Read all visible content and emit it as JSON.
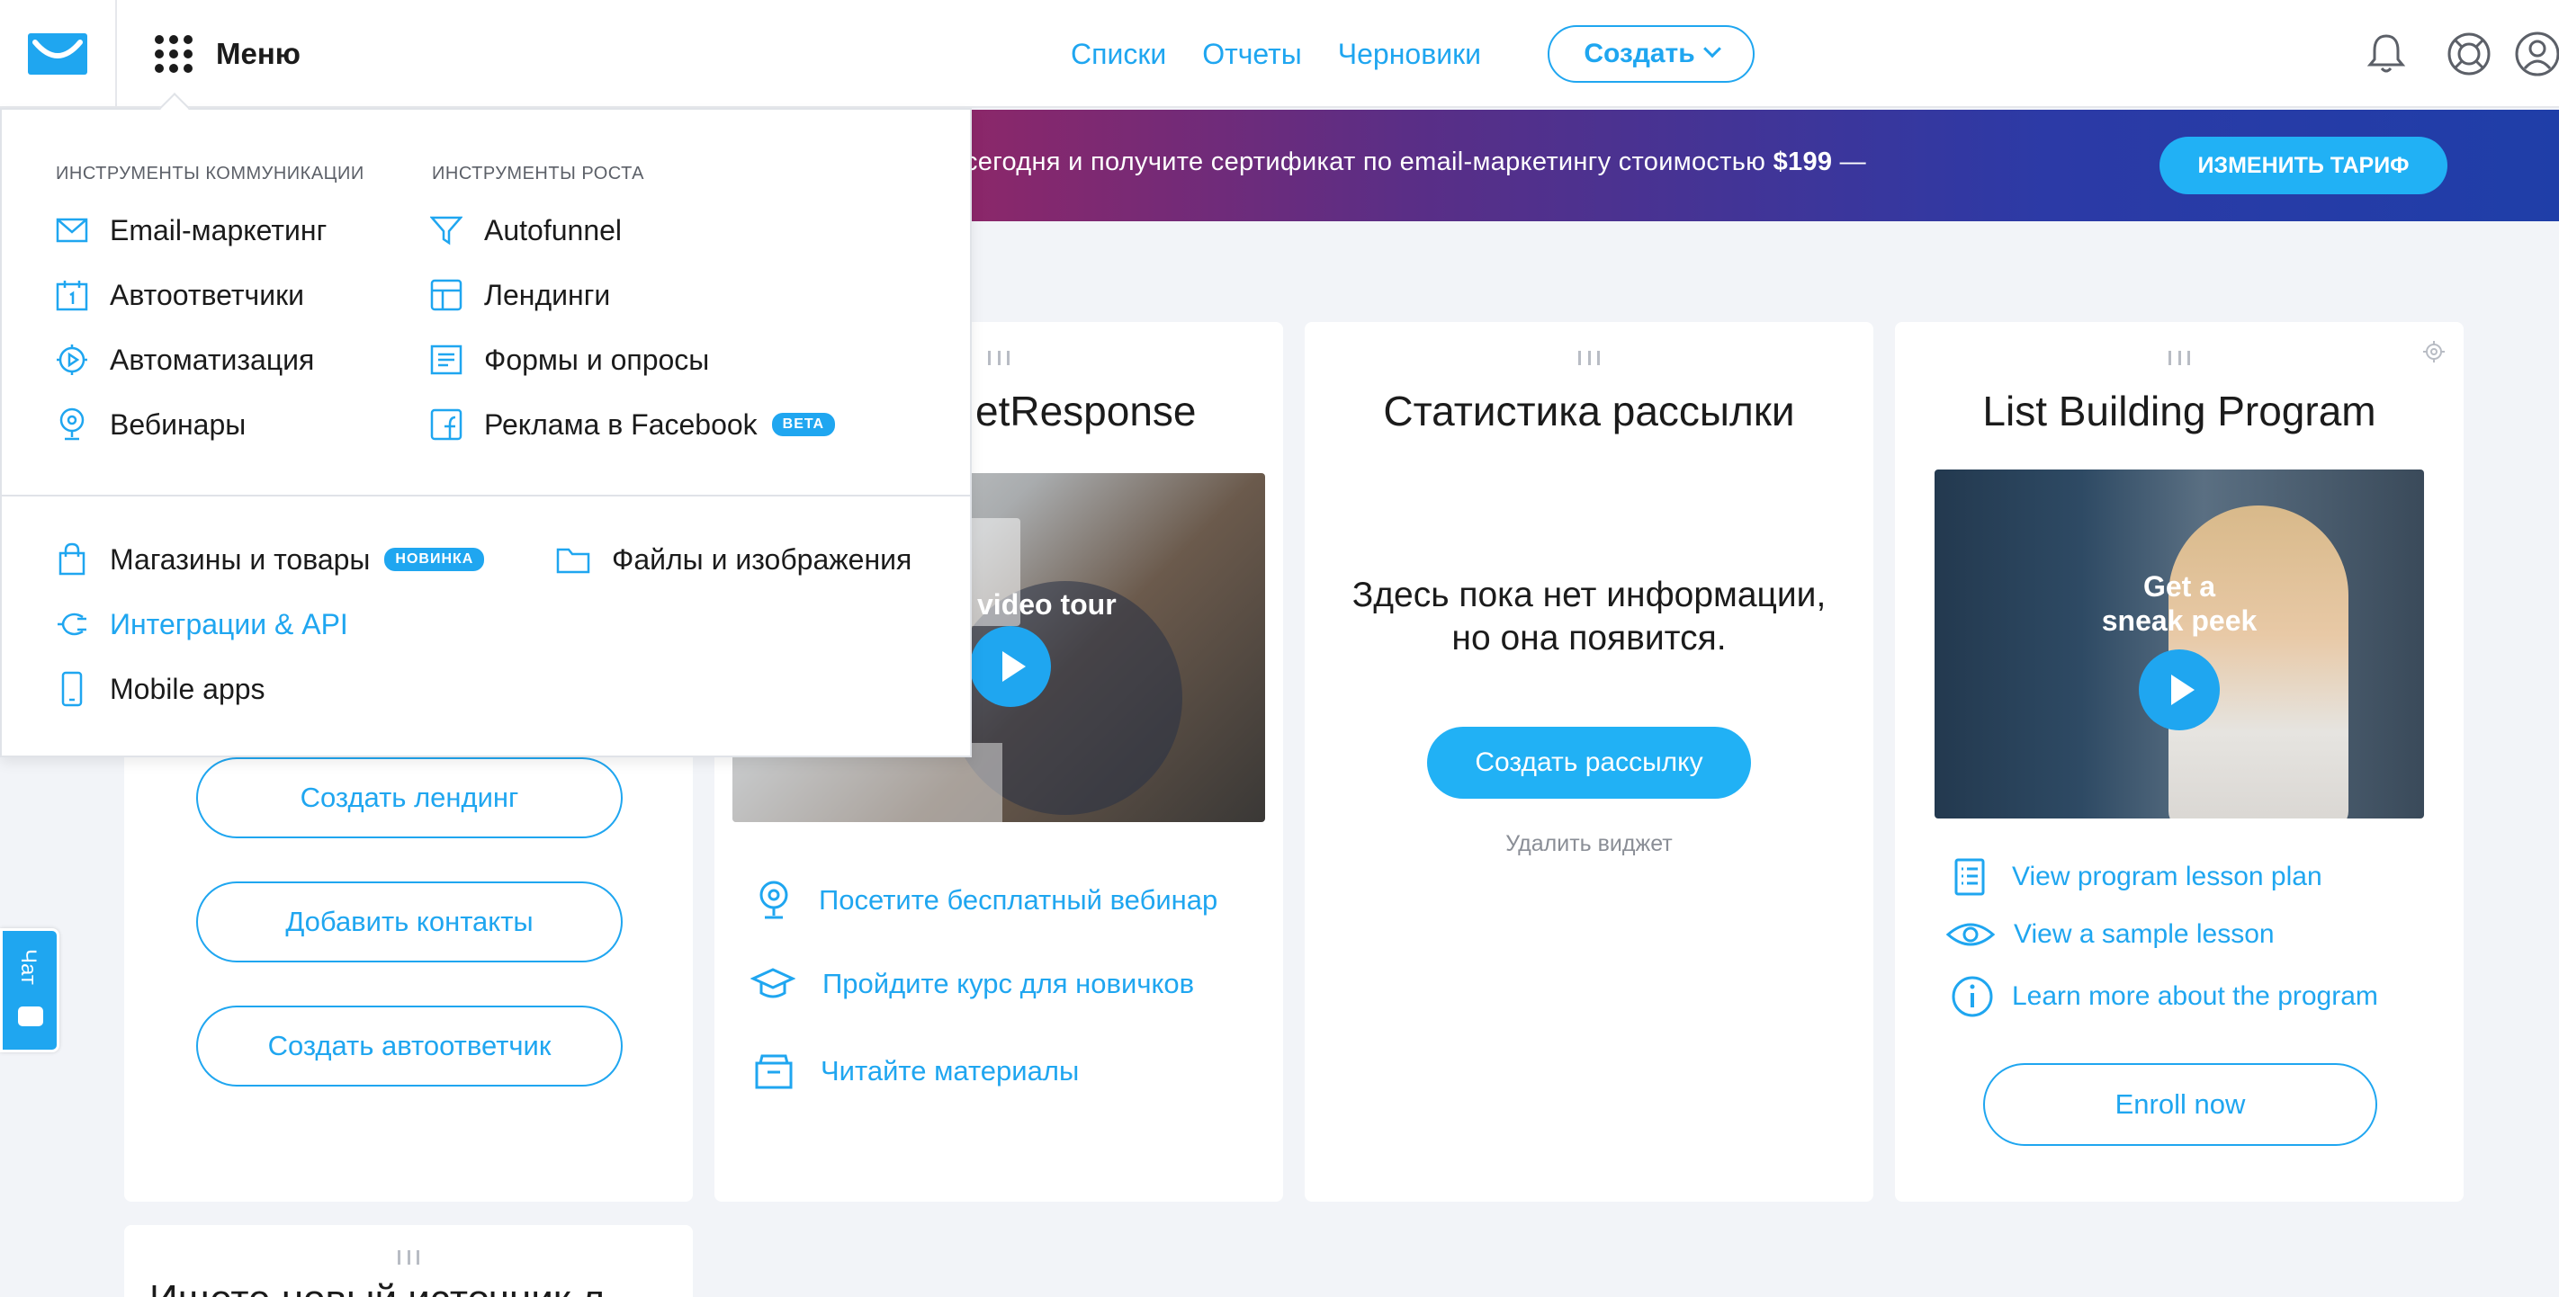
{
  "header": {
    "menu_label": "Меню",
    "nav": [
      "Списки",
      "Отчеты",
      "Черновики"
    ],
    "create_label": "Создать"
  },
  "banner": {
    "text_prefix": "сегодня и получите сертификат по email-маркетингу стоимостью ",
    "text_price": "$199",
    "text_suffix": " —",
    "cta_label": "ИЗМЕНИТЬ ТАРИФ"
  },
  "menu": {
    "communication_heading": "ИНСТРУМЕНТЫ КОММУНИКАЦИИ",
    "growth_heading": "ИНСТРУМЕНТЫ РОСТА",
    "communication_items": [
      {
        "label": "Email-маркетинг",
        "icon": "envelope-icon"
      },
      {
        "label": "Автоответчики",
        "icon": "calendar-icon"
      },
      {
        "label": "Автоматизация",
        "icon": "automation-gear-icon"
      },
      {
        "label": "Вебинары",
        "icon": "webcam-icon"
      }
    ],
    "growth_items": [
      {
        "label": "Autofunnel",
        "icon": "funnel-icon"
      },
      {
        "label": "Лендинги",
        "icon": "landing-layout-icon"
      },
      {
        "label": "Формы и опросы",
        "icon": "form-icon"
      },
      {
        "label": "Реклама в Facebook",
        "icon": "facebook-icon",
        "badge": "BETA"
      }
    ],
    "bottom_items": [
      {
        "label": "Магазины и товары",
        "icon": "shopping-bag-icon",
        "badge": "НОВИНКА"
      },
      {
        "label": "Файлы и изображения",
        "icon": "folder-icon"
      },
      {
        "label": "Интеграции & API",
        "icon": "plug-icon"
      },
      {
        "label": "Mobile apps",
        "icon": "mobile-phone-icon"
      }
    ]
  },
  "quick_actions": {
    "buttons": [
      "Создать лендинг",
      "Добавить контакты",
      "Создать автоответчик"
    ]
  },
  "getresponse_card": {
    "title_visible": "etResponse",
    "video_label": "video tour",
    "links": [
      "Посетите бесплатный вебинар",
      "Пройдите курс для новичков",
      "Читайте материалы"
    ]
  },
  "stats_card": {
    "title": "Статистика рассылки",
    "empty_line1": "Здесь пока нет информации,",
    "empty_line2": "но она появится.",
    "create_label": "Создать рассылку",
    "remove_label": "Удалить виджет"
  },
  "lbp_card": {
    "title": "List Building Program",
    "video_line1": "Get a",
    "video_line2": "sneak peek",
    "links": [
      "View program lesson plan",
      "View a sample lesson",
      "Learn more about the program"
    ],
    "enroll_label": "Enroll now"
  },
  "bottom_card": {
    "title_partial": "Ищете новый источник л"
  },
  "chat": {
    "label": "Чат"
  },
  "colors": {
    "accent": "#1fa6f0",
    "banner_start": "#d61f3e",
    "banner_end": "#1f3ea8"
  }
}
